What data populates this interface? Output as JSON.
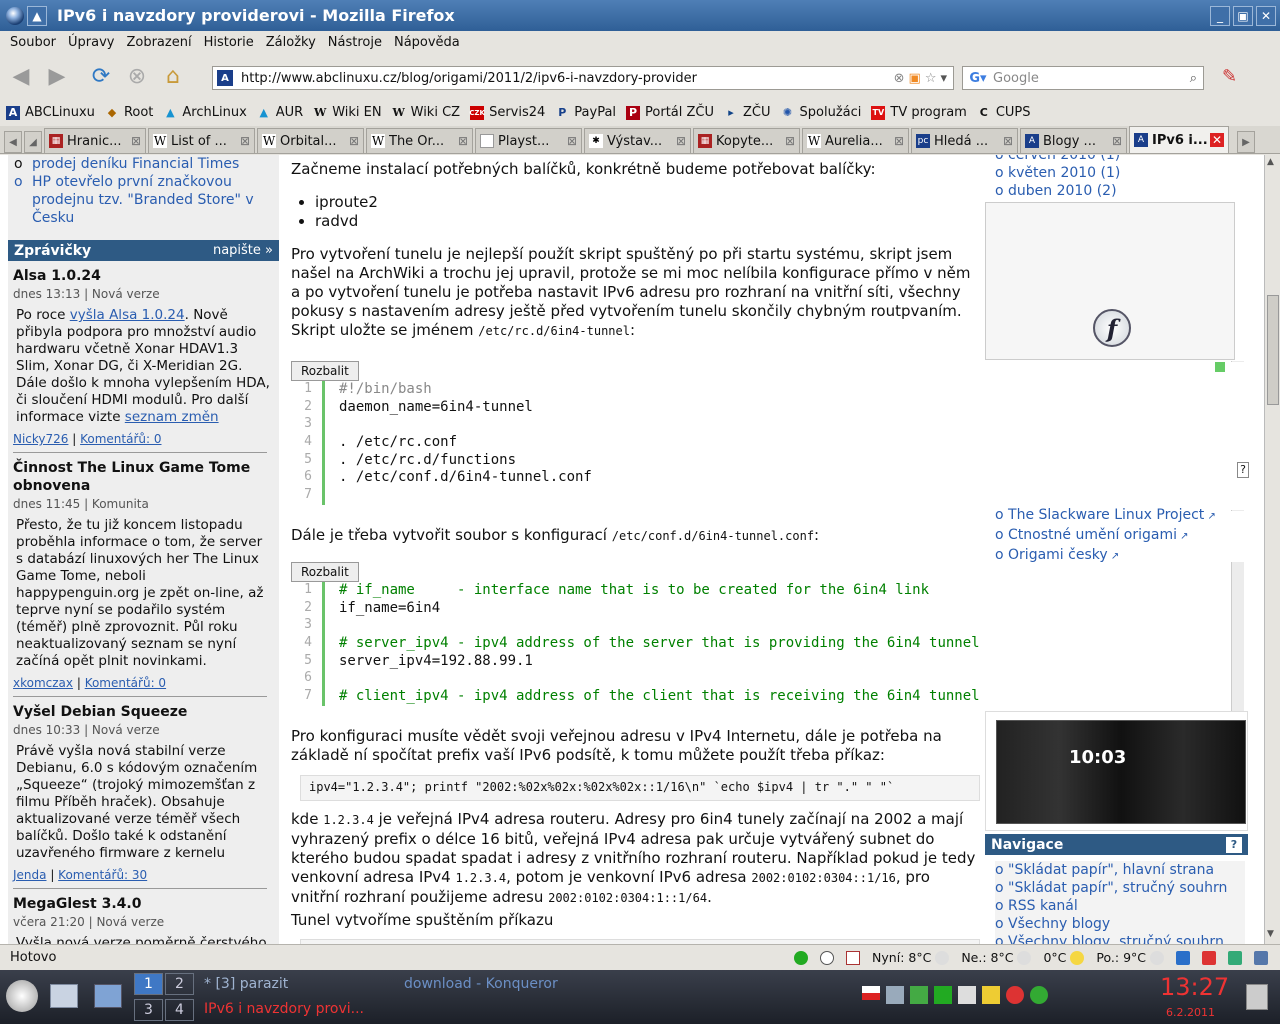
{
  "window": {
    "title": "IPv6 i navzdory providerovi - Mozilla Firefox"
  },
  "menu": [
    "Soubor",
    "Úpravy",
    "Zobrazení",
    "Historie",
    "Záložky",
    "Nástroje",
    "Nápověda"
  ],
  "url": "http://www.abclinuxu.cz/blog/origami/2011/2/ipv6-i-navzdory-provider",
  "search_placeholder": "Google",
  "bookmarks": [
    "ABCLinuxu",
    "Root",
    "ArchLinux",
    "AUR",
    "Wiki EN",
    "Wiki CZ",
    "Servis24",
    "PayPal",
    "Portál ZČU",
    "ZČU",
    "Spolužáci",
    "TV program",
    "CUPS"
  ],
  "tabs": [
    "Hranic...",
    "List of ...",
    "Orbital...",
    "The Or...",
    "Playst...",
    "Výstav...",
    "Kopyte...",
    "Aurelia...",
    "Hledá ...",
    "Blogy ...",
    "IPv6 i..."
  ],
  "left": {
    "top_items": [
      "prodej deníku Financial Times",
      "HP otevřelo první značkovou prodejnu tzv. \"Branded Store\" v Česku"
    ],
    "header": "Zprávičky",
    "header_more": "napište »",
    "news": [
      {
        "title": "Alsa 1.0.24",
        "meta": "dnes 13:13 | Nová verze",
        "body_pre": "Po roce ",
        "body_link": "vyšla Alsa 1.0.24",
        "body_rest": ". Nově přibyla podpora pro množství audio hardwaru včetně Xonar HDAV1.3 Slim, Xonar DG, či X-Meridian 2G. Dále došlo k mnoha vylepšením HDA, či sloučení HDMI modulů. Pro další informace vizte ",
        "body_link2": "seznam změn",
        "author": "Nicky726",
        "comments": "Komentářů: 0"
      },
      {
        "title": "Činnost The Linux Game Tome obnovena",
        "meta": "dnes 11:45 | Komunita",
        "body": "Přesto, že tu již koncem listopadu proběhla informace o tom, že server s databází linuxových her The Linux Game Tome, neboli happypenguin.org je zpět on-line, až teprve nyní se podařilo systém (téměř) plně zprovoznit. Půl roku neaktualizovaný seznam se nyní začíná opět plnit novinkami.",
        "author": "xkomczax",
        "comments": "Komentářů: 0"
      },
      {
        "title": "Vyšel Debian Squeeze",
        "meta": "dnes 10:33 | Nová verze",
        "body": "Právě vyšla nová stabilní verze Debianu, 6.0 s kódovým označením „Squeeze“ (trojoký mimozemšťan z filmu Příběh hraček). Obsahuje aktualizované verze téměř všech balíčků. Došlo také k odstanění uzavřeného firmware z kernelu",
        "author": "Jenda",
        "comments": "Komentářů: 30"
      },
      {
        "title": "MegaGlest 3.4.0",
        "meta": "včera 21:20 | Nová verze",
        "body": "Vyšla nová verze poměrně čerstvého"
      }
    ]
  },
  "main": {
    "p1": "Začneme instalací potřebných balíčků, konkrétně budeme potřebovat balíčky:",
    "packages": [
      "iproute2",
      "radvd"
    ],
    "p2": "Pro vytvoření tunelu je nejlepší použít skript spuštěný po při startu systému, skript jsem našel na ArchWiki a trochu jej upravil, protože se mi moc nelíbila konfigurace přímo v něm a po vytvoření tunelu je potřeba nastavit IPv6 adresu pro rozhraní na vnitřní síti, všechny pokusy s nastavením adresy ještě před vytvořením tunelu skončily chybným routpvaním. Skript uložte se jménem ",
    "p2_code": "/etc/rc.d/6in4-tunnel",
    "p2_end": ":",
    "expand": "Rozbalit",
    "code1": [
      "#!/bin/bash",
      "daemon_name=6in4-tunnel",
      "",
      ". /etc/rc.conf",
      ". /etc/rc.d/functions",
      ". /etc/conf.d/6in4-tunnel.conf",
      ""
    ],
    "p3": "Dále je třeba vytvořit soubor s konfigurací ",
    "p3_code": "/etc/conf.d/6in4-tunnel.conf",
    "p3_end": ":",
    "code2": [
      "# if_name     - interface name that is to be created for the 6in4 link",
      "if_name=6in4",
      "",
      "# server_ipv4 - ipv4 address of the server that is providing the 6in4 tunnel",
      "server_ipv4=192.88.99.1",
      "",
      "# client_ipv4 - ipv4 address of the client that is receiving the 6in4 tunnel"
    ],
    "p4": "Pro konfiguraci musíte vědět svoji veřejnou adresu v IPv4 Internetu, dále je potřeba na základě ní spočítat prefix vaší IPv6 podsítě, k tomu můžete použít třeba příkaz:",
    "cmd": "ipv4=\"1.2.3.4\"; printf \"2002:%02x%02x:%02x%02x::1/16\\n\" `echo $ipv4 | tr \".\" \" \"`",
    "p5a": "kde ",
    "p5_c1": "1.2.3.4",
    "p5b": " je veřejná IPv4 adresa routeru. Adresy pro 6in4 tunely začínají na 2002 a mají vyhrazený prefix o délce 16 bitů, veřejná IPv4 adresa pak určuje vytvářený subnet do kterého budou spadat spadat i adresy z vnitřního rozhraní routeru. Například pokud je tedy venkovní adresa IPv4 ",
    "p5_c2": "1.2.3.4",
    "p5c": ", potom je venkovní IPv6 adresa ",
    "p5_c3": "2002:0102:0304::1/16",
    "p5d": ", pro vnitřní rozhraní použijeme adresu ",
    "p5_c4": "2002:0102:0304:1::1/64",
    "p5e": ".",
    "p6": "Tunel vytvoříme spuštěním příkazu"
  },
  "right": {
    "months": [
      "červen 2010 (1)",
      "květen 2010 (1)",
      "duben 2010 (2)"
    ],
    "links": [
      "The Slackware Linux Project",
      "Ctnostné umění origami",
      "Origami česky"
    ],
    "ad_clock": "10:03",
    "nav_header": "Navigace",
    "nav_help": "?",
    "nav": [
      "\"Skládat papír\", hlavní strana",
      "\"Skládat papír\", stručný souhrn",
      "RSS kanál",
      "Všechny blogy",
      "Všechny blogy, stručný souhrn"
    ]
  },
  "status": {
    "text": "Hotovo",
    "now": "Nyní: 8°C",
    "next": "Ne.: 8°C",
    "t0": "0°C",
    "mon": "Po.: 9°C"
  },
  "taskbar": {
    "desks": [
      "1",
      "2",
      "3",
      "4"
    ],
    "t1": "* [3] parazit",
    "t2": "download - Konqueror",
    "t3": "IPv6 i navzdory provi...",
    "time": "13:27",
    "date": "6.2.2011"
  }
}
